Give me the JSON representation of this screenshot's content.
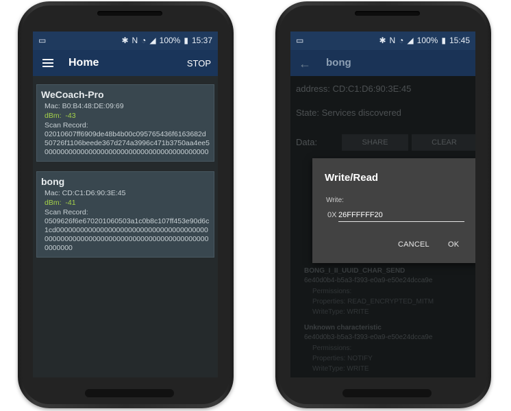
{
  "left_phone": {
    "status": {
      "time": "15:37",
      "battery": "100%"
    },
    "appbar": {
      "title": "Home",
      "action": "STOP"
    },
    "devices": [
      {
        "name": "WeCoach-Pro",
        "mac": "Mac: B0:B4:48:DE:09:69",
        "dbm_label": "dBm:",
        "dbm_value": "-43",
        "scan_label": "Scan Record:",
        "scan_record": "02010607ff6909de48b4b00c095765436f6163682d50726f1106beede367d274a3996c471b3750aa4ee500000000000000000000000000000000000000000"
      },
      {
        "name": "bong",
        "mac": "Mac: CD:C1:D6:90:3E:45",
        "dbm_label": "dBm:",
        "dbm_value": "-41",
        "scan_label": "Scan Record:",
        "scan_record": "0509626f6e670201060503a1c0b8c107ff453e90d6c1cd00000000000000000000000000000000000000000000000000000000000000000000000000000000000000"
      }
    ]
  },
  "right_phone": {
    "status": {
      "time": "15:45",
      "battery": "100%"
    },
    "appbar": {
      "title": "bong"
    },
    "address": "address: CD:C1:D6:90:3E:45",
    "state": "State: Services discovered",
    "data_label": "Data:",
    "share_label": "SHARE",
    "clear_label": "CLEAR",
    "characteristics": [
      {
        "name": "BONG_I_II_UUID_CHAR_SEND",
        "uuid": "6e40d0b4-b5a3-f393-e0a9-e50e24dcca9e",
        "permissions": "Permissions:",
        "properties": "Properties: READ_ENCRYPTED_MITM",
        "writetype": "WriteType: WRITE"
      },
      {
        "name": "Unknown characteristic",
        "uuid": "6e40d0b3-b5a3-f393-e0a9-e50e24dcca9e",
        "permissions": "Permissions:",
        "properties": "Properties: NOTIFY",
        "writetype": "WriteType: WRITE"
      }
    ],
    "dialog": {
      "title": "Write/Read",
      "label": "Write:",
      "prefix": "0X",
      "value": "26FFFFFF20",
      "cancel": "CANCEL",
      "ok": "OK"
    }
  }
}
